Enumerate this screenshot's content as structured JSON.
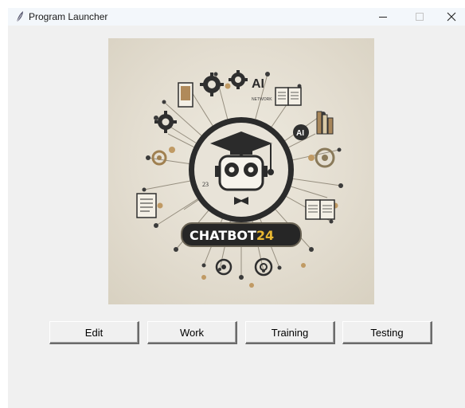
{
  "window": {
    "title": "Program Launcher",
    "icon": "feather-icon",
    "controls": [
      "minimize-icon",
      "maximize-icon",
      "close-icon"
    ]
  },
  "logo": {
    "brand_text_white": "CHATBOT",
    "brand_text_accent": "24",
    "accent_color": "#e9b832",
    "ai_label": "AI",
    "ai_sub_label": "NETWORK",
    "robot_badge_number": "23",
    "background_color": "#e6e1d5"
  },
  "buttons": [
    {
      "label": "Edit"
    },
    {
      "label": "Work"
    },
    {
      "label": "Training"
    },
    {
      "label": "Testing"
    }
  ]
}
